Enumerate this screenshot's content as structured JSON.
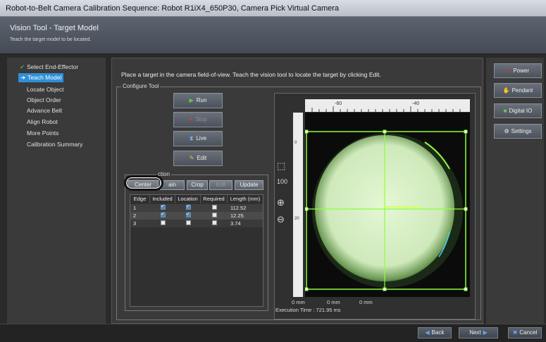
{
  "window": {
    "title": "Robot-to-Belt Camera Calibration Sequence: Robot R1iX4_650P30, Camera Pick Virtual Camera"
  },
  "header": {
    "title": "Vision Tool - Target Model",
    "subtitle": "Teach the target model to be located."
  },
  "steps": [
    {
      "label": "Select End-Effector",
      "state": "done"
    },
    {
      "label": "Teach Model",
      "state": "active"
    },
    {
      "label": "Locate Object",
      "state": "pending"
    },
    {
      "label": "Object Order",
      "state": "pending"
    },
    {
      "label": "Advance Belt",
      "state": "pending"
    },
    {
      "label": "Align Robot",
      "state": "pending"
    },
    {
      "label": "More Points",
      "state": "pending"
    },
    {
      "label": "Calibration Summary",
      "state": "pending"
    }
  ],
  "instructions": "Place a target in the camera field-of-view.  Teach the vision tool to locate the target by clicking Edit.",
  "configure": {
    "group_label": "Configure Tool",
    "buttons": {
      "run": "Run",
      "stop": "Stop",
      "live": "Live",
      "edit": "Edit"
    },
    "section_label": "ction",
    "section_buttons": {
      "center": "Center",
      "train": "ain",
      "crop": "Crop",
      "edit": "Edit",
      "update": "Update"
    },
    "table": {
      "columns": [
        "Edge",
        "Included",
        "Location",
        "Required",
        "Length (mm)"
      ],
      "rows": [
        {
          "edge": "1",
          "included": true,
          "location": true,
          "required": false,
          "length": "112.52"
        },
        {
          "edge": "2",
          "included": true,
          "location": true,
          "required": false,
          "length": "12.25"
        },
        {
          "edge": "3",
          "included": false,
          "location": false,
          "required": false,
          "length": "3.74"
        }
      ]
    }
  },
  "viewer": {
    "ruler_unit": "mm",
    "ruler_top": [
      "-60",
      "-40"
    ],
    "ruler_left": [
      "0",
      "20"
    ],
    "readout_x": "0 mm",
    "readout_y": "0 mm",
    "readout_z": "0 mm",
    "execution_time": "Execution Time : 721.95 ms",
    "zoom_label": "100"
  },
  "right": {
    "power": "Power",
    "pendant": "Pendant",
    "digital_io": "Digital IO",
    "settings": "Settings"
  },
  "nav": {
    "back": "Back",
    "next": "Next",
    "cancel": "Cancel"
  },
  "colors": {
    "accent": "#2f8fd8",
    "overlay": "#8cff3c",
    "power_red": "#d23a3a",
    "run_green": "#5ccf4a"
  }
}
